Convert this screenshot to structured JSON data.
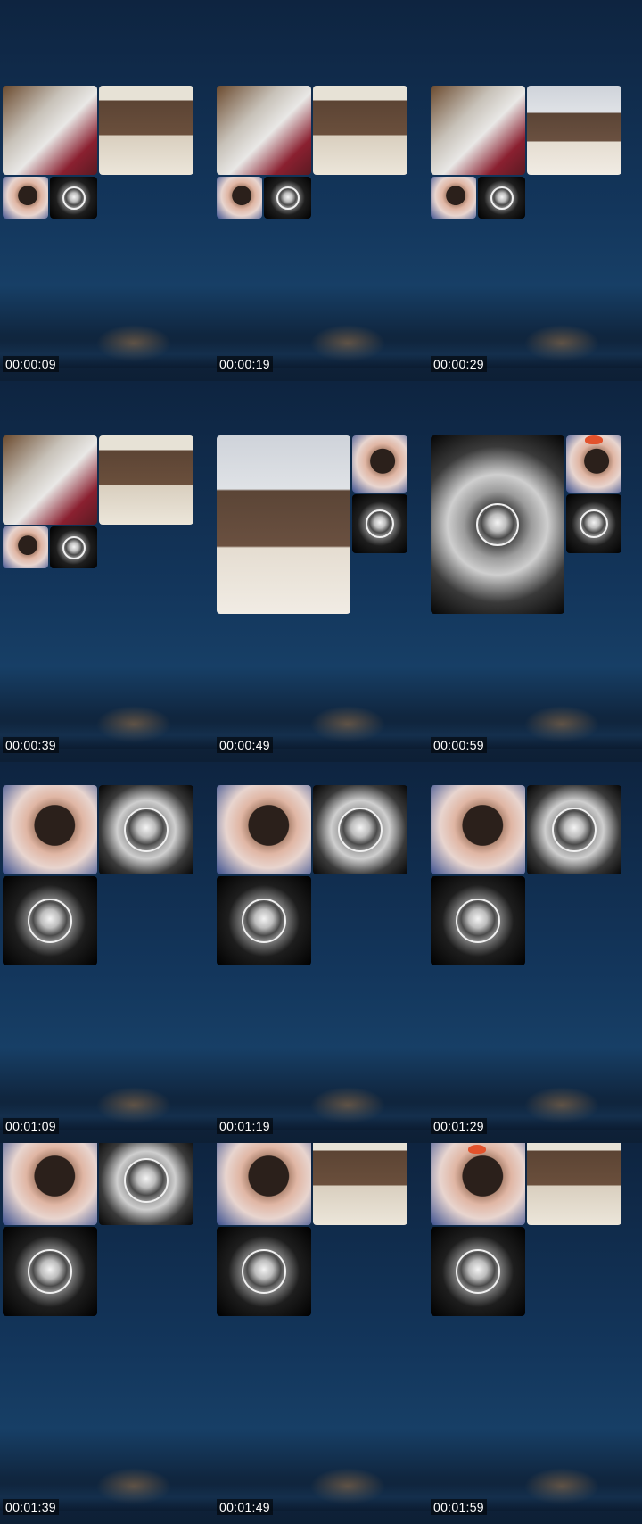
{
  "timestamps": [
    "00:00:09",
    "00:00:19",
    "00:00:29",
    "00:00:39",
    "00:00:49",
    "00:00:59",
    "00:01:09",
    "00:01:19",
    "00:01:29",
    "00:01:39",
    "00:01:49",
    "00:01:59"
  ],
  "colors": {
    "background": "#0f2a48",
    "timestamp_text": "#ffffff",
    "timestamp_bg": "#000000"
  }
}
